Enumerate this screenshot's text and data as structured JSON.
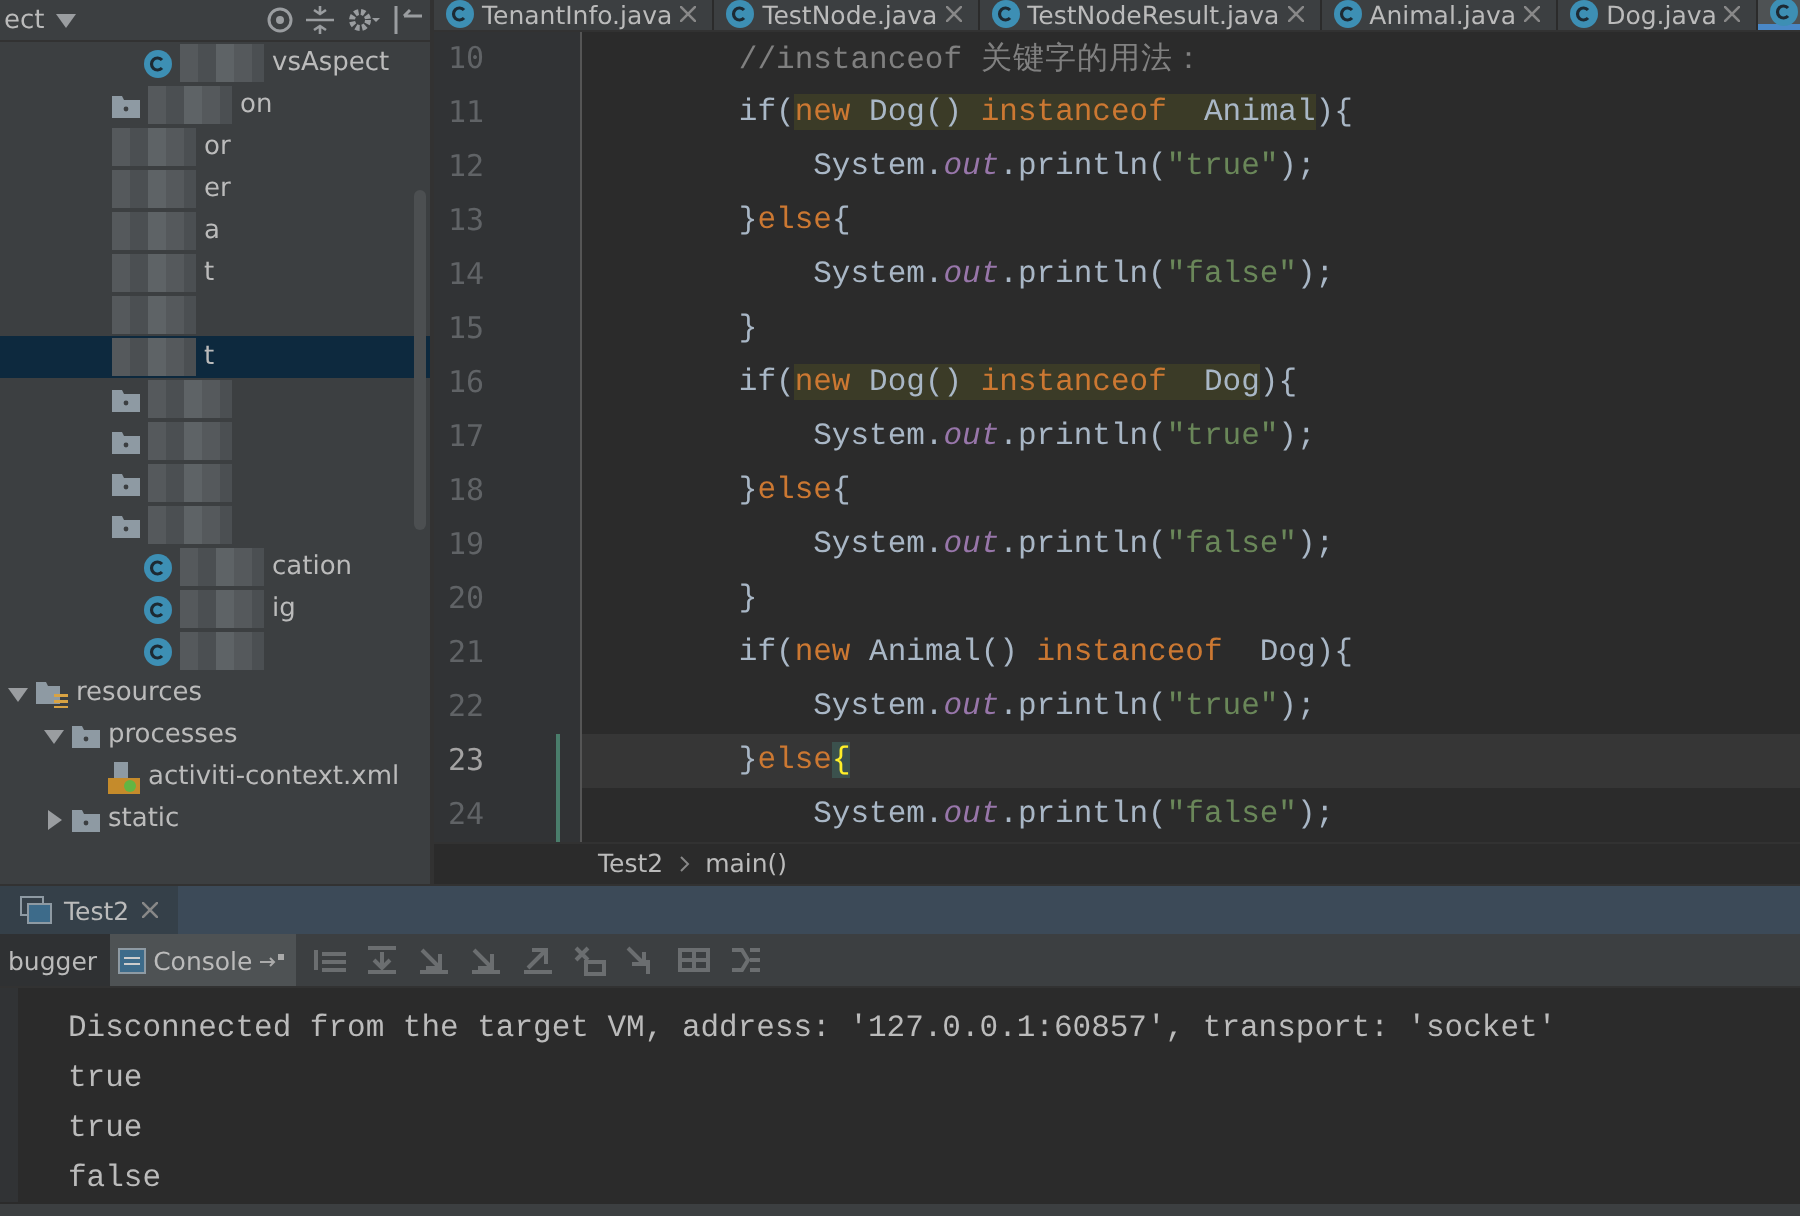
{
  "project_panel": {
    "title": "ect",
    "rows": [
      {
        "kind": "class",
        "label": "vsAspect",
        "blurred": true,
        "selected": false
      },
      {
        "kind": "folder",
        "label": "on",
        "blurred": true,
        "selected": false
      },
      {
        "label": "or",
        "blurred": true,
        "selected": false
      },
      {
        "label": "er",
        "blurred": true,
        "selected": false
      },
      {
        "label": "a",
        "blurred": true,
        "selected": false
      },
      {
        "label": "t",
        "blurred": true,
        "selected": false
      },
      {
        "blurred": true,
        "selected": false
      },
      {
        "label": "t",
        "blurred": true,
        "selected": true
      },
      {
        "kind": "folder",
        "blurred": true,
        "selected": false
      },
      {
        "kind": "folder",
        "blurred": true,
        "selected": false
      },
      {
        "kind": "folder",
        "blurred": true,
        "selected": false
      },
      {
        "kind": "folder",
        "blurred": true,
        "selected": false
      },
      {
        "kind": "class",
        "label": "cation",
        "blurred": true,
        "selected": false
      },
      {
        "kind": "class",
        "label": "ig",
        "blurred": true,
        "selected": false
      },
      {
        "kind": "class",
        "blurred": true,
        "selected": false
      }
    ],
    "tree": [
      {
        "label": "resources",
        "kind": "resources",
        "expanded": true,
        "children": [
          {
            "label": "processes",
            "kind": "folder",
            "expanded": true,
            "children": [
              {
                "label": "activiti-context.xml",
                "kind": "xml"
              }
            ]
          },
          {
            "label": "static",
            "kind": "folder",
            "expanded": false
          }
        ]
      }
    ]
  },
  "editor": {
    "tabs": [
      {
        "label": "TenantInfo.java",
        "selected": false
      },
      {
        "label": "TestNode.java",
        "selected": false
      },
      {
        "label": "TestNodeResult.java",
        "selected": false
      },
      {
        "label": "Animal.java",
        "selected": false
      },
      {
        "label": "Dog.java",
        "selected": false
      },
      {
        "selected": true
      }
    ],
    "lines": [
      {
        "number": "10",
        "current": false,
        "segments": [
          {
            "text": "        //instanceof 关键字的用法：",
            "kind": "comment"
          }
        ]
      },
      {
        "number": "11",
        "current": false,
        "segments": [
          {
            "text": "        if(",
            "kind": "plain"
          },
          {
            "text": "new",
            "kind": "keyword",
            "highlight": true
          },
          {
            "text": " Dog() ",
            "kind": "plain",
            "highlight": true
          },
          {
            "text": "instanceof",
            "kind": "keyword",
            "highlight": true
          },
          {
            "text": "  Animal",
            "kind": "plain",
            "highlight": true
          },
          {
            "text": "){",
            "kind": "plain"
          }
        ]
      },
      {
        "number": "12",
        "current": false,
        "segments": [
          {
            "text": "            System.",
            "kind": "plain"
          },
          {
            "text": "out",
            "kind": "static"
          },
          {
            "text": ".println(",
            "kind": "plain"
          },
          {
            "text": "\"true\"",
            "kind": "string"
          },
          {
            "text": ");",
            "kind": "plain"
          }
        ]
      },
      {
        "number": "13",
        "current": false,
        "segments": [
          {
            "text": "        }",
            "kind": "plain"
          },
          {
            "text": "else",
            "kind": "keyword"
          },
          {
            "text": "{",
            "kind": "plain"
          }
        ]
      },
      {
        "number": "14",
        "current": false,
        "segments": [
          {
            "text": "            System.",
            "kind": "plain"
          },
          {
            "text": "out",
            "kind": "static"
          },
          {
            "text": ".println(",
            "kind": "plain"
          },
          {
            "text": "\"false\"",
            "kind": "string"
          },
          {
            "text": ");",
            "kind": "plain"
          }
        ]
      },
      {
        "number": "15",
        "current": false,
        "segments": [
          {
            "text": "        }",
            "kind": "plain"
          }
        ]
      },
      {
        "number": "16",
        "current": false,
        "segments": [
          {
            "text": "        if(",
            "kind": "plain"
          },
          {
            "text": "new",
            "kind": "keyword",
            "highlight": true
          },
          {
            "text": " Dog() ",
            "kind": "plain",
            "highlight": true
          },
          {
            "text": "instanceof",
            "kind": "keyword",
            "highlight": true
          },
          {
            "text": "  Dog",
            "kind": "plain",
            "highlight": true
          },
          {
            "text": "){",
            "kind": "plain"
          }
        ]
      },
      {
        "number": "17",
        "current": false,
        "segments": [
          {
            "text": "            System.",
            "kind": "plain"
          },
          {
            "text": "out",
            "kind": "static"
          },
          {
            "text": ".println(",
            "kind": "plain"
          },
          {
            "text": "\"true\"",
            "kind": "string"
          },
          {
            "text": ");",
            "kind": "plain"
          }
        ]
      },
      {
        "number": "18",
        "current": false,
        "segments": [
          {
            "text": "        }",
            "kind": "plain"
          },
          {
            "text": "else",
            "kind": "keyword"
          },
          {
            "text": "{",
            "kind": "plain"
          }
        ]
      },
      {
        "number": "19",
        "current": false,
        "segments": [
          {
            "text": "            System.",
            "kind": "plain"
          },
          {
            "text": "out",
            "kind": "static"
          },
          {
            "text": ".println(",
            "kind": "plain"
          },
          {
            "text": "\"false\"",
            "kind": "string"
          },
          {
            "text": ");",
            "kind": "plain"
          }
        ]
      },
      {
        "number": "20",
        "current": false,
        "segments": [
          {
            "text": "        }",
            "kind": "plain"
          }
        ]
      },
      {
        "number": "21",
        "current": false,
        "segments": [
          {
            "text": "        if(",
            "kind": "plain"
          },
          {
            "text": "new",
            "kind": "keyword"
          },
          {
            "text": " Animal() ",
            "kind": "plain"
          },
          {
            "text": "instanceof",
            "kind": "keyword"
          },
          {
            "text": "  Dog",
            "kind": "plain"
          },
          {
            "text": "){",
            "kind": "plain"
          }
        ]
      },
      {
        "number": "22",
        "current": false,
        "segments": [
          {
            "text": "            System.",
            "kind": "plain"
          },
          {
            "text": "out",
            "kind": "static"
          },
          {
            "text": ".println(",
            "kind": "plain"
          },
          {
            "text": "\"true\"",
            "kind": "string"
          },
          {
            "text": ");",
            "kind": "plain"
          }
        ]
      },
      {
        "number": "23",
        "current": true,
        "segments": [
          {
            "text": "        }",
            "kind": "plain"
          },
          {
            "text": "else",
            "kind": "keyword"
          },
          {
            "text": "{",
            "kind": "brace"
          }
        ]
      },
      {
        "number": "24",
        "current": false,
        "segments": [
          {
            "text": "            System.",
            "kind": "plain"
          },
          {
            "text": "out",
            "kind": "static"
          },
          {
            "text": ".println(",
            "kind": "plain"
          },
          {
            "text": "\"false\"",
            "kind": "string"
          },
          {
            "text": ");",
            "kind": "plain"
          }
        ]
      }
    ],
    "breadcrumbs": [
      "Test2",
      "main()"
    ]
  },
  "run_panel": {
    "title": "Test2",
    "tabs": [
      {
        "label": "bugger",
        "selected": false
      },
      {
        "label": "Console",
        "selected": true
      }
    ],
    "console": [
      "Disconnected from the target VM, address: '127.0.0.1:60857', transport: 'socket'",
      "true",
      "true",
      "false"
    ]
  }
}
